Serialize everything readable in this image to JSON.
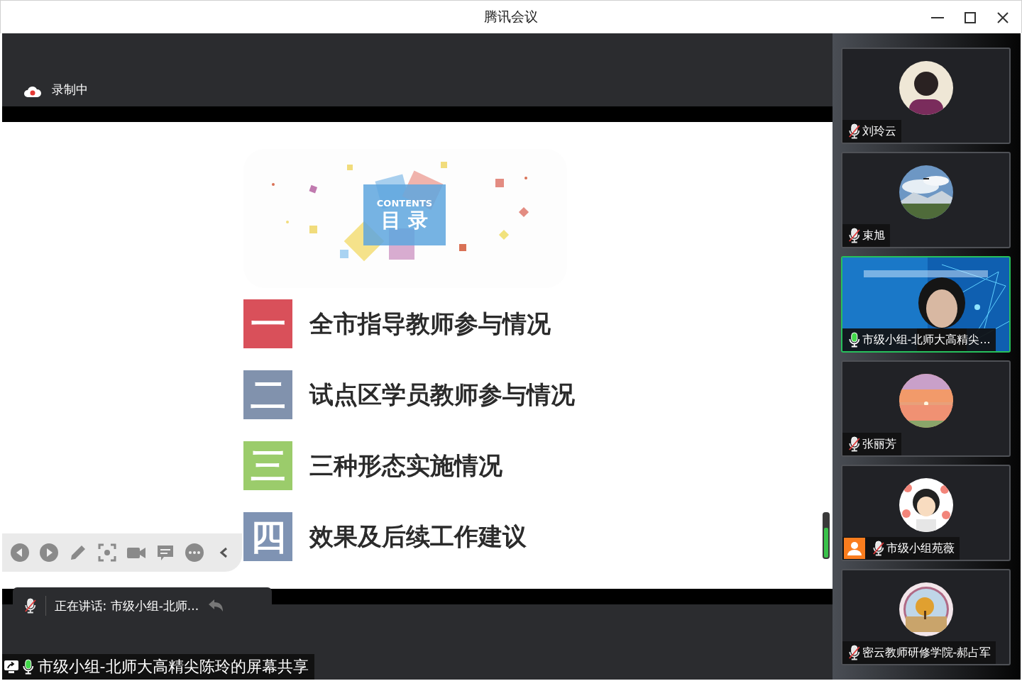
{
  "window": {
    "title": "腾讯会议"
  },
  "recording": {
    "label": "录制中"
  },
  "slide": {
    "contents_en": "CONTENTS",
    "contents_zh": "目 录",
    "items": [
      {
        "numeral": "一",
        "color": "#d9505a",
        "text": "全市指导教师参与情况"
      },
      {
        "numeral": "二",
        "color": "#8192ad",
        "text": "试点区学员教师参与情况"
      },
      {
        "numeral": "三",
        "color": "#9bcc6b",
        "text": "三种形态实施情况"
      },
      {
        "numeral": "四",
        "color": "#7f93b3",
        "text": "效果及后续工作建议"
      }
    ]
  },
  "speaking": {
    "label": "正在讲话: 市级小组-北师...",
    "muted": true
  },
  "share_banner": {
    "label": "市级小组-北师大高精尖陈玲的屏幕共享",
    "muted": false
  },
  "participants": [
    {
      "name": "刘玲云",
      "muted": true,
      "speaking": false,
      "host": false,
      "kind": "avatar"
    },
    {
      "name": "束旭",
      "muted": true,
      "speaking": false,
      "host": false,
      "kind": "avatar"
    },
    {
      "name": "市级小组-北师大高精尖...",
      "muted": false,
      "speaking": true,
      "host": false,
      "kind": "video"
    },
    {
      "name": "张丽芳",
      "muted": true,
      "speaking": false,
      "host": false,
      "kind": "avatar"
    },
    {
      "name": "市级小组苑薇",
      "muted": true,
      "speaking": false,
      "host": true,
      "kind": "avatar"
    },
    {
      "name": "密云教师研修学院-郝占军",
      "muted": true,
      "speaking": false,
      "host": false,
      "kind": "avatar"
    }
  ]
}
